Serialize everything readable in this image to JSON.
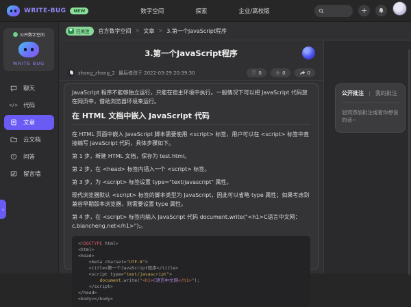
{
  "topbar": {
    "brand": "WRITE-BUG",
    "new_badge": "NEW",
    "nav": [
      "数字空间",
      "探索",
      "企业/高校版"
    ],
    "search_value": ""
  },
  "sidebar": {
    "space_badge": "公开数字空间",
    "space_name": "WRITE BUG",
    "items": [
      {
        "key": "chat",
        "label": "聊天",
        "active": false
      },
      {
        "key": "code",
        "label": "代码",
        "active": false
      },
      {
        "key": "article",
        "label": "文章",
        "active": true
      },
      {
        "key": "clouddoc",
        "label": "云文档",
        "active": false
      },
      {
        "key": "qa",
        "label": "问答",
        "active": false
      },
      {
        "key": "wall",
        "label": "留言墙",
        "active": false
      }
    ]
  },
  "breadcrumb": {
    "follow_badge": "已关注",
    "separator": ">",
    "items": [
      "官方数字空间",
      "文章",
      "3.第一个JavaScript程序"
    ]
  },
  "article": {
    "title": "3.第一个JavaScript程序",
    "author": "zhang_zhang_2",
    "modified": "最后修改于 2022-03-29 20:39:30",
    "stats": [
      {
        "icon": "heart",
        "count": "0"
      },
      {
        "icon": "star",
        "count": "0"
      },
      {
        "icon": "share",
        "count": "0"
      }
    ],
    "body": [
      {
        "type": "p",
        "text": "JavaScript 程序不能够独立运行，只能在宿主环境中执行。一般情况下可以把 JavaScript 代码放在网页中，借助浏览器环境来运行。"
      },
      {
        "type": "h2",
        "text": "在 HTML 文档中嵌入 JavaScript 代码"
      },
      {
        "type": "p",
        "text": "在 HTML 页面中嵌入 JavaScript 脚本需要使用 <script> 标签，用户可以在 <script> 标签中直接编写 JavaScript 代码，具体步骤如下。"
      },
      {
        "type": "p",
        "text": "第 1 步，新建 HTML 文档，保存为 test.html。"
      },
      {
        "type": "p",
        "text": "第 2 步，在 <head> 标签内插入一个 <script> 标签。"
      },
      {
        "type": "p",
        "text": "第 3 步，为 <script> 标签设置 type=\"text/javascript\" 属性。"
      },
      {
        "type": "p",
        "text": "现代浏览器默认 <script> 标签的脚本类型为 JavaScript，因此可以省略 type 属性；如果考虑到兼容早期版本浏览器，则需要设置 type 属性。"
      },
      {
        "type": "p",
        "text": "第 4 步，在 <script> 标签内输入 JavaScript 代码 document.write(\"<h1>C语言中文网：c.biancheng.net</h1>\");。"
      }
    ]
  },
  "code_block": {
    "lines": [
      [
        {
          "c": "p",
          "t": "<!"
        },
        {
          "c": "r",
          "t": "DOCTYPE"
        },
        {
          "c": "p",
          "t": " html>"
        }
      ],
      [
        {
          "c": "p",
          "t": "<html>"
        }
      ],
      [
        {
          "c": "p",
          "t": "<head>"
        }
      ],
      [
        {
          "c": "p",
          "t": "    <meta charset="
        },
        {
          "c": "y",
          "t": "\"UTF-8\""
        },
        {
          "c": "p",
          "t": ">"
        }
      ],
      [
        {
          "c": "p",
          "t": "    <title>第一个JavaScript程序</title>"
        }
      ],
      [
        {
          "c": "p",
          "t": "    <script type="
        },
        {
          "c": "y",
          "t": "\"text/javascript\""
        },
        {
          "c": "p",
          "t": ">"
        }
      ],
      [
        {
          "c": "p",
          "t": "        "
        },
        {
          "c": "y",
          "t": "document"
        },
        {
          "c": "p",
          "t": ".write("
        },
        {
          "c": "o",
          "t": "\"<h1>"
        },
        {
          "c": "m",
          "t": "C语言中文网"
        },
        {
          "c": "o",
          "t": "</h1>\""
        },
        {
          "c": "p",
          "t": ");"
        }
      ],
      [
        {
          "c": "p",
          "t": "    </script>"
        }
      ],
      [
        {
          "c": "p",
          "t": "</head>"
        }
      ],
      [
        {
          "c": "p",
          "t": "<body></body>"
        }
      ]
    ]
  },
  "annotation_panel": {
    "tabs": [
      {
        "label": "公开批注",
        "active": true
      },
      {
        "label": "我的批注",
        "active": false
      }
    ],
    "divider": "|",
    "placeholder": "划词添加批注或者你想说的话~"
  },
  "colors": {
    "accent_purple": "#6b5bf5",
    "brand_purple": "#9187f7",
    "badge_green": "#8bd79a",
    "code_red": "#e0596b",
    "code_yellow": "#cdb054"
  }
}
